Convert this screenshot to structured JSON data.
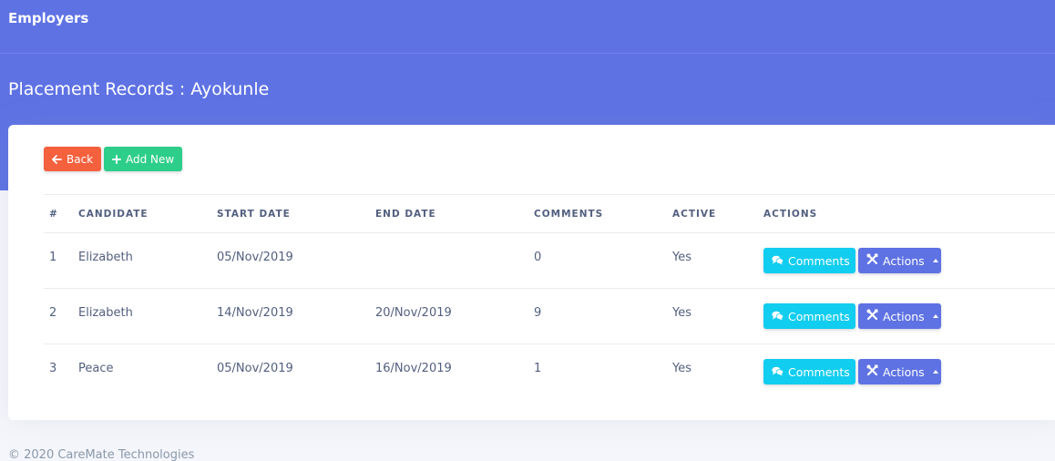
{
  "topbar": {
    "brand": "Employers"
  },
  "page": {
    "title": "Placement Records : Ayokunle"
  },
  "toolbar": {
    "back_label": "Back",
    "add_label": "Add New"
  },
  "table": {
    "headers": [
      "#",
      "CANDIDATE",
      "START DATE",
      "END DATE",
      "COMMENTS",
      "ACTIVE",
      "ACTIONS"
    ],
    "rows": [
      {
        "num": "1",
        "candidate": "Elizabeth",
        "start": "05/Nov/2019",
        "end": "",
        "comments": "0",
        "active": "Yes"
      },
      {
        "num": "2",
        "candidate": "Elizabeth",
        "start": "14/Nov/2019",
        "end": "20/Nov/2019",
        "comments": "9",
        "active": "Yes"
      },
      {
        "num": "3",
        "candidate": "Peace",
        "start": "05/Nov/2019",
        "end": "16/Nov/2019",
        "comments": "1",
        "active": "Yes"
      }
    ],
    "comments_label": "Comments",
    "actions_label": "Actions"
  },
  "footer": {
    "text": "© 2020 CareMate Technologies"
  },
  "colors": {
    "primary": "#5e72e4",
    "danger": "#f5603d",
    "success": "#2dce89",
    "info": "#11cdef"
  }
}
